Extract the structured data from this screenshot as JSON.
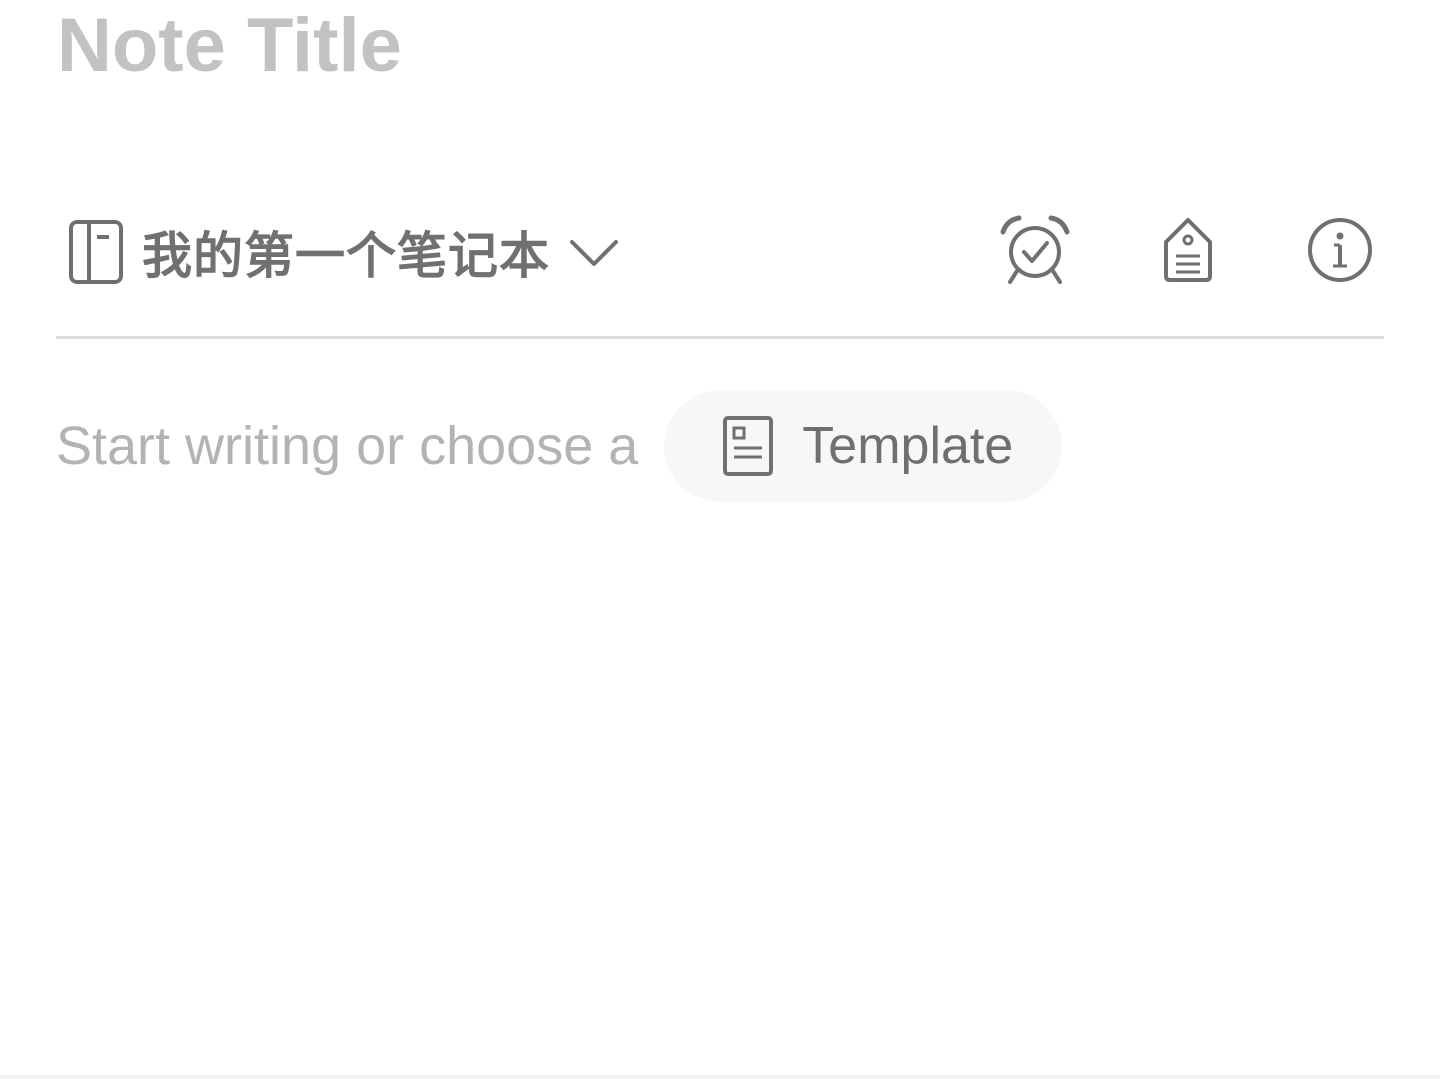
{
  "note": {
    "title_placeholder": "Note Title"
  },
  "toolbar": {
    "notebook": {
      "icon": "notebook-icon",
      "name": "我的第一个笔记本",
      "chevron_icon": "chevron-down-icon"
    },
    "actions": [
      {
        "icon": "alarm-clock-check-icon"
      },
      {
        "icon": "tag-icon"
      },
      {
        "icon": "info-icon"
      }
    ]
  },
  "editor": {
    "placeholder": "Start writing or choose a",
    "template_button": {
      "icon": "template-icon",
      "label": "Template"
    }
  },
  "colors": {
    "title_placeholder": "#c2c2c2",
    "icon": "#707070",
    "divider": "#dcdcdc",
    "placeholder": "#b3b3b3",
    "template_bg": "#f7f7f7"
  }
}
